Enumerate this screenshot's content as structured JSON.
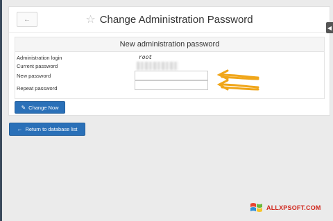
{
  "header": {
    "back_icon": "←",
    "star_icon": "☆",
    "title": "Change Administration Password"
  },
  "form": {
    "heading": "New administration password",
    "fields": {
      "login": {
        "label": "Administration login",
        "value": "root"
      },
      "current": {
        "label": "Current password"
      },
      "new": {
        "label": "New password",
        "value": ""
      },
      "repeat": {
        "label": "Repeat password",
        "value": ""
      }
    },
    "submit": {
      "icon": "✎",
      "label": "Change Now"
    }
  },
  "actions": {
    "return": {
      "icon": "←",
      "label": "Return to database list"
    }
  },
  "watermark": {
    "text": "ALLXPSOFT.COM"
  },
  "colors": {
    "button": "#2a70b8",
    "arrow": "#f0a61a",
    "watermark": "#d0261c"
  }
}
